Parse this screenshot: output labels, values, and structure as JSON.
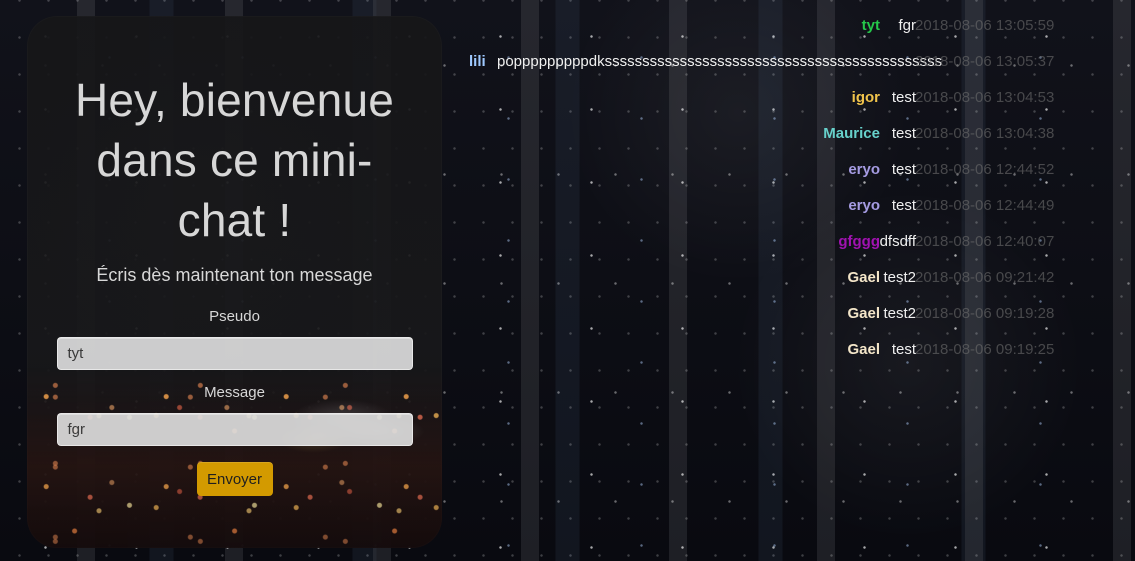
{
  "panel": {
    "title_lines": [
      "Hey, bienvenue",
      "dans ce mini-",
      "chat !"
    ],
    "subtitle": "Écris dès maintenant ton message",
    "pseudo_label": "Pseudo",
    "pseudo_value": "tyt",
    "message_label": "Message",
    "message_value": "fgr",
    "submit_label": "Envoyer"
  },
  "colors": {
    "accent": "#d39a00",
    "panel_bg": "#18181a",
    "text": "#d8d8d8",
    "timestamp": "#6e6e6e"
  },
  "messages": [
    {
      "user": "tyt",
      "text": "fgr",
      "time": "2018-08-06 13:05:59",
      "user_color": "#25c84a"
    },
    {
      "user": "lili",
      "text": "popppppppppdksssssssssssssssssssssssssssssssssssssssssssss",
      "time": "2018-08-06 13:05:37",
      "user_color": "#9fc9ff"
    },
    {
      "user": "igor",
      "text": "test",
      "time": "2018-08-06 13:04:53",
      "user_color": "#f1c44b"
    },
    {
      "user": "Maurice",
      "text": "test",
      "time": "2018-08-06 13:04:38",
      "user_color": "#67d1cb"
    },
    {
      "user": "eryo",
      "text": "test",
      "time": "2018-08-06 12:44:52",
      "user_color": "#a59be2"
    },
    {
      "user": "eryo",
      "text": "test",
      "time": "2018-08-06 12:44:49",
      "user_color": "#a59be2"
    },
    {
      "user": "gfggg",
      "text": "dfsdff",
      "time": "2018-08-06 12:40:07",
      "user_color": "#a112b1"
    },
    {
      "user": "Gael",
      "text": "test2",
      "time": "2018-08-06 09:21:42",
      "user_color": "#f3e5c8"
    },
    {
      "user": "Gael",
      "text": "test2",
      "time": "2018-08-06 09:19:28",
      "user_color": "#f3e5c8"
    },
    {
      "user": "Gael",
      "text": "test",
      "time": "2018-08-06 09:19:25",
      "user_color": "#f3e5c8"
    }
  ]
}
